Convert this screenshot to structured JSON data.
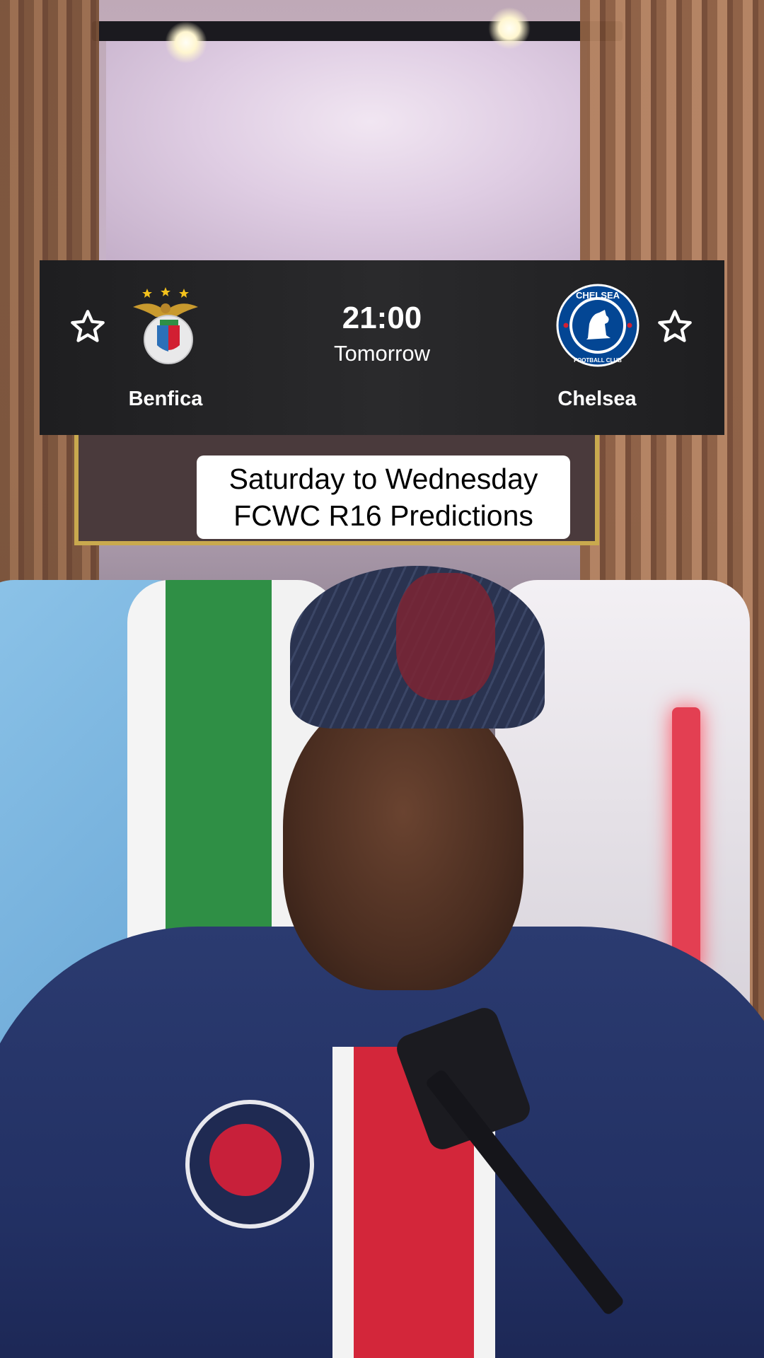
{
  "match": {
    "home_team": "Benfica",
    "away_team": "Chelsea",
    "kickoff_time": "21:00",
    "kickoff_day": "Tomorrow",
    "home_favorite_icon": "star-outline-icon",
    "away_favorite_icon": "star-outline-icon",
    "home_crest_icon": "benfica-crest-icon",
    "away_crest_icon": "chelsea-crest-icon",
    "away_crest_text_top": "CHELSEA",
    "away_crest_text_bottom": "FOOTBALL CLUB"
  },
  "caption": {
    "line1": "Saturday to Wednesday",
    "line2": "FCWC R16 Predictions"
  },
  "colors": {
    "scorebar_bg": "#232325",
    "caption_bg": "#ffffff",
    "chelsea_blue": "#034694",
    "benfica_red": "#c8102e"
  }
}
